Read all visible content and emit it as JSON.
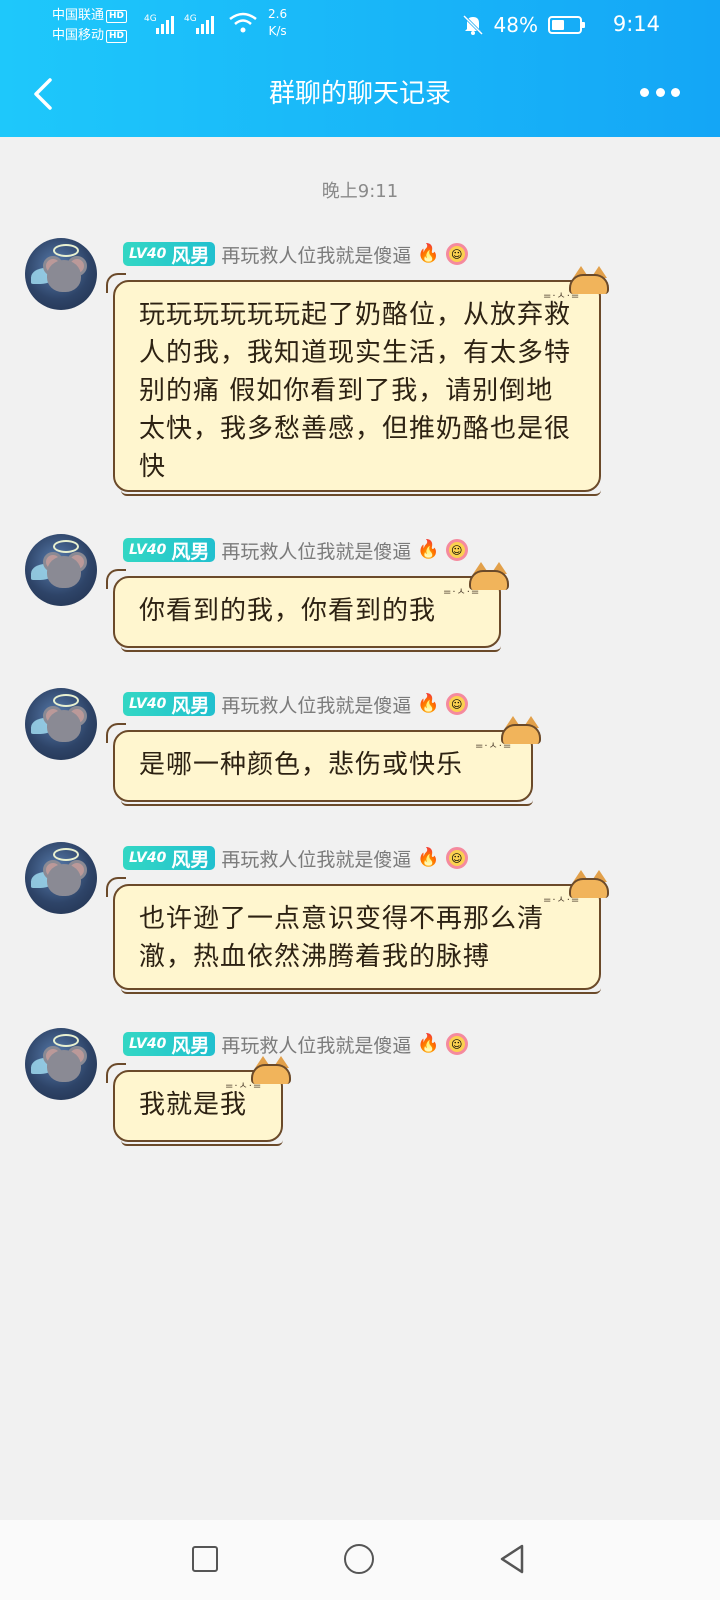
{
  "status_bar": {
    "carrier1": "中国联通",
    "carrier2": "中国移动",
    "hd_badge": "HD",
    "net_label": "4G",
    "speed_value": "2.6",
    "speed_unit": "K/s",
    "battery_percent": "48%",
    "battery_level": 0.48,
    "time": "9:14"
  },
  "header": {
    "title": "群聊的聊天记录",
    "back_icon": "chevron-left-icon",
    "more_icon": "more-horizontal-icon"
  },
  "timestamp": "晚上9:11",
  "sender": {
    "level": "LV40",
    "tag": "风男",
    "nickname": "再玩救人位我就是傻逼"
  },
  "messages": [
    {
      "text": "玩玩玩玩玩玩起了奶酪位，从放弃救人的我，我知道现实生活，有太多特别的痛 假如你看到了我，请别倒地太快，我多愁善感，但推奶酪也是很快"
    },
    {
      "text": "你看到的我，你看到的我"
    },
    {
      "text": "是哪一种颜色，悲伤或快乐"
    },
    {
      "text": "也许逊了一点意识变得不再那么清澈，热血依然沸腾着我的脉搏"
    },
    {
      "text": "我就是我"
    }
  ],
  "nav": {
    "recent_icon": "square-icon",
    "home_icon": "circle-icon",
    "back_icon": "triangle-back-icon"
  },
  "colors": {
    "header_gradient_start": "#1ec8fb",
    "header_gradient_end": "#14a6f6",
    "bubble_fill": "#fff6cf",
    "bubble_border": "#6b4a2a",
    "level_badge": "#21c0cf"
  }
}
